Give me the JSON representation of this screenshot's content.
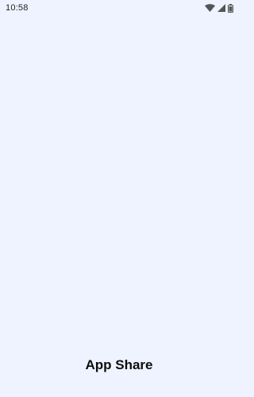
{
  "status_bar": {
    "time": "10:58",
    "icons": [
      "wifi-icon",
      "cellular-signal-icon",
      "battery-icon"
    ]
  },
  "splash": {
    "app_name": "App Share"
  },
  "colors": {
    "background": "#eef3ff",
    "text": "#0d0d0d",
    "status_icons": "#555555"
  }
}
